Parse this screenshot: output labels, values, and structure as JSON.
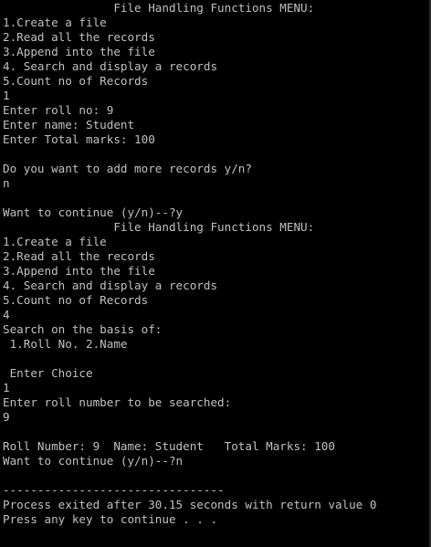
{
  "console": {
    "lines": [
      "                File Handling Functions MENU:",
      "1.Create a file",
      "2.Read all the records",
      "3.Append into the file",
      "4. Search and display a records",
      "5.Count no of Records",
      "1",
      "Enter roll no: 9",
      "Enter name: Student",
      "Enter Total marks: 100",
      "",
      "Do you want to add more records y/n?",
      "n",
      "",
      "Want to continue (y/n)--?y",
      "                File Handling Functions MENU:",
      "1.Create a file",
      "2.Read all the records",
      "3.Append into the file",
      "4. Search and display a records",
      "5.Count no of Records",
      "4",
      "Search on the basis of:",
      " 1.Roll No. 2.Name",
      "",
      " Enter Choice",
      "1",
      "Enter roll number to be searched:",
      "9",
      "",
      "Roll Number: 9  Name: Student   Total Marks: 100",
      "Want to continue (y/n)--?n",
      "",
      "--------------------------------",
      "Process exited after 30.15 seconds with return value 0",
      "Press any key to continue . . ."
    ]
  },
  "colors": {
    "background": "#000000",
    "text": "#c0c0c0"
  }
}
